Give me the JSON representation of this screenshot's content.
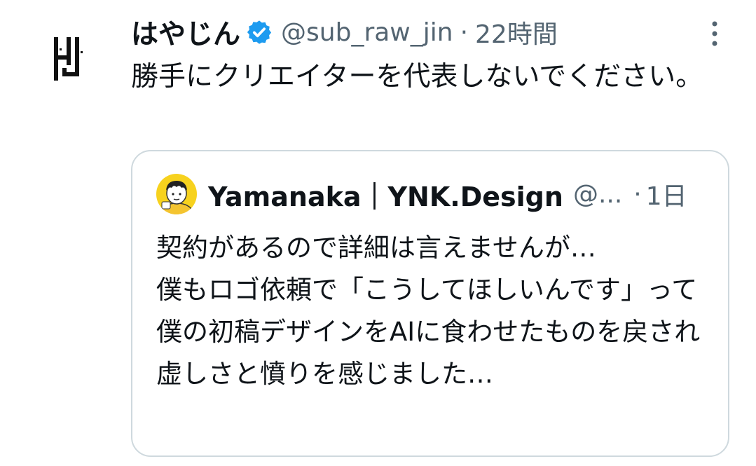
{
  "tweet": {
    "display_name": "はやじん",
    "handle": "@sub_raw_jin",
    "separator": "·",
    "time": "22時間",
    "text": "勝手にクリエイターを代表しないでください。",
    "avatar_icon": "hj-logo-icon",
    "verified_icon": "verified-badge-icon",
    "verified_color": "#1d9bf0",
    "more_icon": "more-vertical-icon"
  },
  "quote": {
    "display_name": "Yamanaka｜YNK.Design",
    "handle": "@...",
    "separator": "·",
    "time": "1日",
    "text": "契約があるので詳細は言えませんが…\n僕もロゴ依頼で「こうしてほしいんです」って僕の初稿デザインをAIに食わせたものを戻され虚しさと憤りを感じました…",
    "avatar_icon": "cartoon-avatar-icon",
    "avatar_bg": "#f7d21e"
  },
  "colors": {
    "text_primary": "#0f1419",
    "text_secondary": "#536471",
    "border": "#cfd9de"
  }
}
